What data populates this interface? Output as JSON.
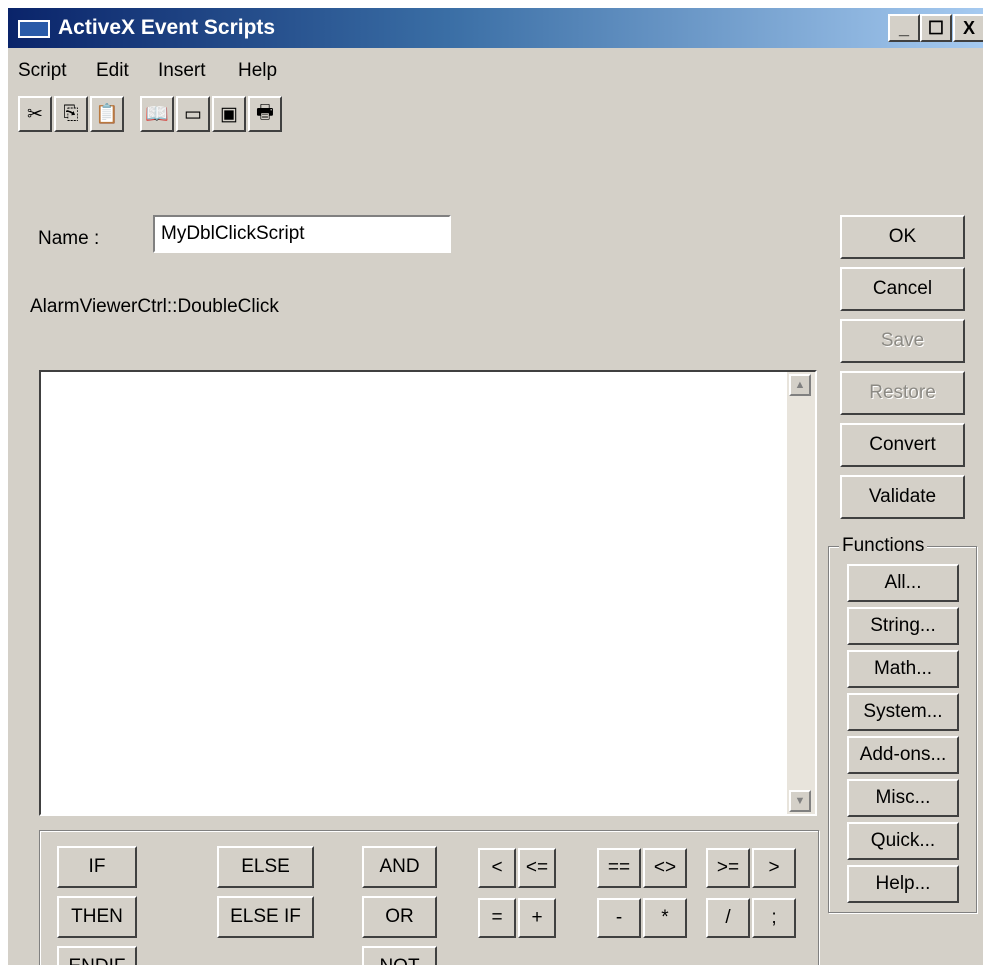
{
  "window": {
    "title": "ActiveX Event Scripts",
    "minimize": "_",
    "maximize": "☐",
    "close": "X"
  },
  "menu": [
    "Script",
    "Edit",
    "Insert",
    "Help"
  ],
  "toolbar": [
    {
      "icon": "cut-icon",
      "glyph": "✂"
    },
    {
      "icon": "copy-icon",
      "glyph": "⎘"
    },
    {
      "icon": "paste-icon",
      "glyph": "📋"
    },
    {
      "icon": "tag-browser-icon",
      "glyph": "📖"
    },
    {
      "icon": "window-icon",
      "glyph": "▭"
    },
    {
      "icon": "activex-icon",
      "glyph": "▣"
    },
    {
      "icon": "print-icon",
      "glyph": "🖶"
    }
  ],
  "name_label": "Name :",
  "name_value": "MyDblClickScript",
  "event_label": "AlarmViewerCtrl::DoubleClick",
  "editor_text": "",
  "buttons": {
    "ok": "OK",
    "cancel": "Cancel",
    "save": "Save",
    "restore": "Restore",
    "convert": "Convert",
    "validate": "Validate"
  },
  "functions": {
    "label": "Functions",
    "items": [
      "All...",
      "String...",
      "Math...",
      "System...",
      "Add-ons...",
      "Misc...",
      "Quick...",
      "Help..."
    ]
  },
  "operators": {
    "if": "IF",
    "then": "THEN",
    "endif": "ENDIF",
    "else": "ELSE",
    "elseif": "ELSE IF",
    "and": "AND",
    "or": "OR",
    "not": "NOT",
    "lt": "<",
    "le": "<=",
    "eq": "=",
    "plus": "+",
    "eqeq": "==",
    "ne": "<>",
    "minus": "-",
    "mult": "*",
    "ge": ">=",
    "gt": ">",
    "div": "/",
    "semi": ";"
  }
}
